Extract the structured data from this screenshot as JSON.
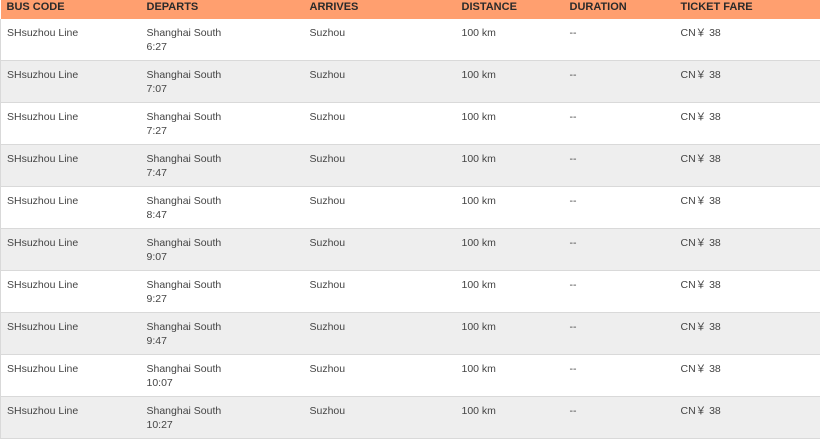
{
  "headers": {
    "bus_code": "BUS CODE",
    "departs": "DEPARTS",
    "arrives": "ARRIVES",
    "distance": "DISTANCE",
    "duration": "DURATION",
    "ticket_fare": "TICKET FARE"
  },
  "colors": {
    "header_bg": "#ff9f6f",
    "row_alt_bg": "#eeeeee"
  },
  "rows": [
    {
      "bus_code": "SHsuzhou Line",
      "depart_station": "Shanghai South",
      "depart_time": "6:27",
      "arrives": "Suzhou",
      "distance": "100 km",
      "duration": "--",
      "fare": "CN￥ 38"
    },
    {
      "bus_code": "SHsuzhou Line",
      "depart_station": "Shanghai South",
      "depart_time": "7:07",
      "arrives": "Suzhou",
      "distance": "100 km",
      "duration": "--",
      "fare": "CN￥ 38"
    },
    {
      "bus_code": "SHsuzhou Line",
      "depart_station": "Shanghai South",
      "depart_time": "7:27",
      "arrives": "Suzhou",
      "distance": "100 km",
      "duration": "--",
      "fare": "CN￥ 38"
    },
    {
      "bus_code": "SHsuzhou Line",
      "depart_station": "Shanghai South",
      "depart_time": "7:47",
      "arrives": "Suzhou",
      "distance": "100 km",
      "duration": "--",
      "fare": "CN￥ 38"
    },
    {
      "bus_code": "SHsuzhou Line",
      "depart_station": "Shanghai South",
      "depart_time": "8:47",
      "arrives": "Suzhou",
      "distance": "100 km",
      "duration": "--",
      "fare": "CN￥ 38"
    },
    {
      "bus_code": "SHsuzhou Line",
      "depart_station": "Shanghai South",
      "depart_time": "9:07",
      "arrives": "Suzhou",
      "distance": "100 km",
      "duration": "--",
      "fare": "CN￥ 38"
    },
    {
      "bus_code": "SHsuzhou Line",
      "depart_station": "Shanghai South",
      "depart_time": "9:27",
      "arrives": "Suzhou",
      "distance": "100 km",
      "duration": "--",
      "fare": "CN￥ 38"
    },
    {
      "bus_code": "SHsuzhou Line",
      "depart_station": "Shanghai South",
      "depart_time": "9:47",
      "arrives": "Suzhou",
      "distance": "100 km",
      "duration": "--",
      "fare": "CN￥ 38"
    },
    {
      "bus_code": "SHsuzhou Line",
      "depart_station": "Shanghai South",
      "depart_time": "10:07",
      "arrives": "Suzhou",
      "distance": "100 km",
      "duration": "--",
      "fare": "CN￥ 38"
    },
    {
      "bus_code": "SHsuzhou Line",
      "depart_station": "Shanghai South",
      "depart_time": "10:27",
      "arrives": "Suzhou",
      "distance": "100 km",
      "duration": "--",
      "fare": "CN￥ 38"
    }
  ]
}
